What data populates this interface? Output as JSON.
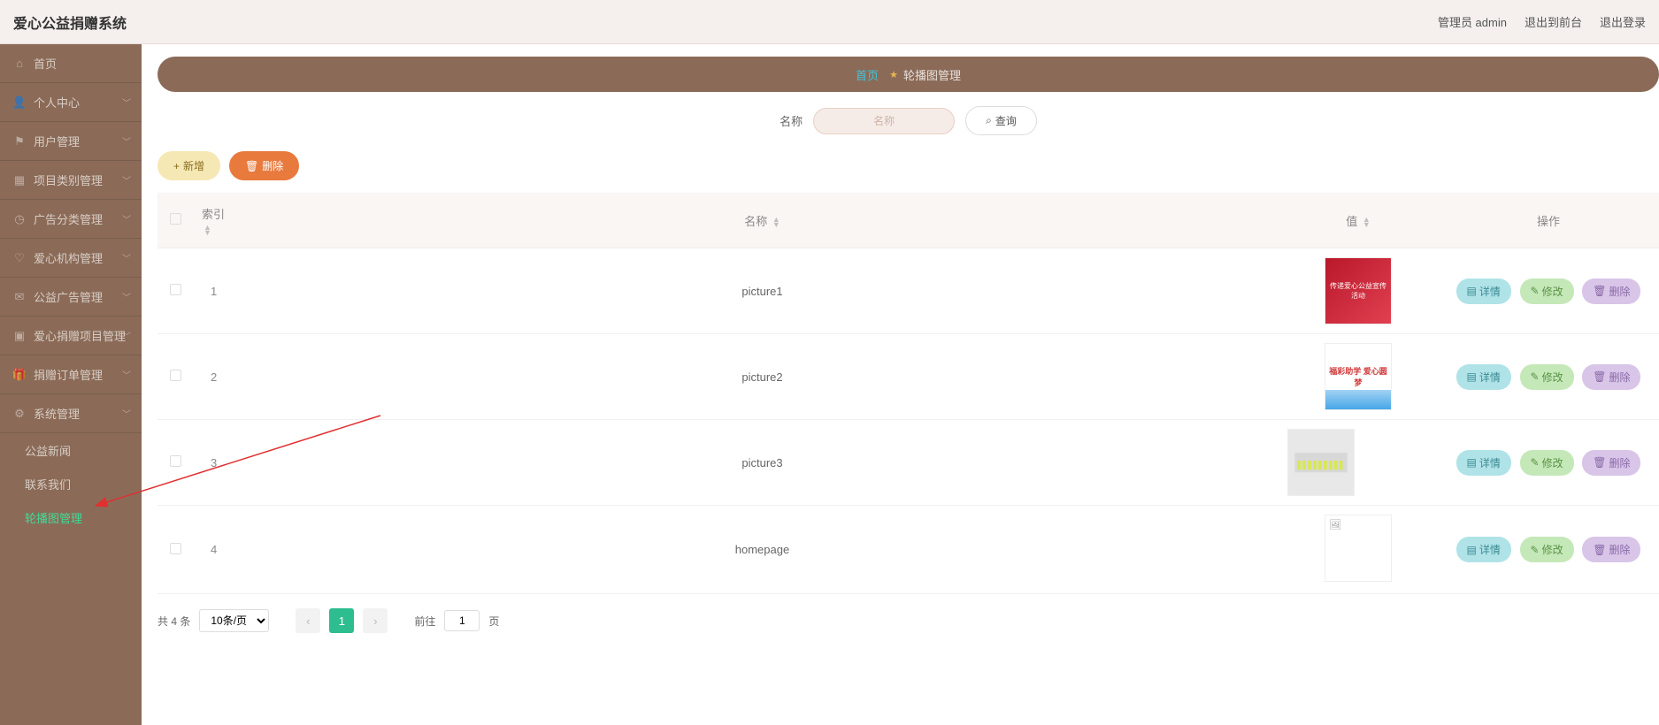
{
  "app_title": "爱心公益捐赠系统",
  "top_right": {
    "admin": "管理员 admin",
    "back": "退出到前台",
    "logout": "退出登录"
  },
  "sidebar": [
    {
      "label": "首页",
      "icon": "home"
    },
    {
      "label": "个人中心",
      "icon": "user",
      "chev": true
    },
    {
      "label": "用户管理",
      "icon": "flag",
      "chev": true
    },
    {
      "label": "项目类别管理",
      "icon": "grid",
      "chev": true
    },
    {
      "label": "广告分类管理",
      "icon": "clock",
      "chev": true
    },
    {
      "label": "爱心机构管理",
      "icon": "heart",
      "chev": true
    },
    {
      "label": "公益广告管理",
      "icon": "mail",
      "chev": true
    },
    {
      "label": "爱心捐赠项目管理",
      "icon": "apps",
      "chev": true
    },
    {
      "label": "捐赠订单管理",
      "icon": "gift",
      "chev": true
    },
    {
      "label": "系统管理",
      "icon": "cog",
      "chev": true
    }
  ],
  "submenu": [
    {
      "label": "公益新闻"
    },
    {
      "label": "联系我们"
    },
    {
      "label": "轮播图管理",
      "active": true
    }
  ],
  "breadcrumb": {
    "home": "首页",
    "current": "轮播图管理"
  },
  "search": {
    "label": "名称",
    "placeholder": "名称",
    "query_btn": "查询"
  },
  "toolbar": {
    "add": "新增",
    "delete": "删除"
  },
  "table": {
    "cols": {
      "index": "索引",
      "name": "名称",
      "value": "值",
      "ops": "操作"
    },
    "rows": [
      {
        "index": "1",
        "name": "picture1",
        "thumb": "red"
      },
      {
        "index": "2",
        "name": "picture2",
        "thumb": "blue"
      },
      {
        "index": "3",
        "name": "picture3",
        "thumb": "group"
      },
      {
        "index": "4",
        "name": "homepage",
        "thumb": "empty"
      }
    ],
    "ops": {
      "detail": "详情",
      "edit": "修改",
      "delete": "删除"
    }
  },
  "pager": {
    "total": "共 4 条",
    "page_size_label": "10条/页",
    "current": "1",
    "goto_prefix": "前往",
    "goto_val": "1",
    "goto_suffix": "页"
  },
  "icons": {
    "home": "⌂",
    "user": "👤",
    "flag": "⚑",
    "grid": "▦",
    "clock": "◷",
    "heart": "♡",
    "mail": "✉",
    "apps": "▣",
    "gift": "🎁",
    "cog": "⚙",
    "chev_down": "﹀",
    "star": "★",
    "search": "⌕",
    "plus": "+",
    "trash": "🗑",
    "doc": "▤",
    "pen": "✎",
    "sort_up": "▲",
    "sort_down": "▼",
    "arr_l": "‹",
    "arr_r": "›"
  }
}
